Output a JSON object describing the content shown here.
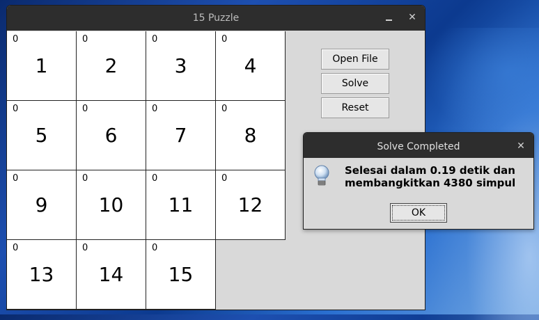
{
  "window": {
    "title": "15 Puzzle",
    "minimize_icon": "minimize-icon",
    "close_icon": "close-icon"
  },
  "board": {
    "tiles": [
      {
        "count": "0",
        "number": "1"
      },
      {
        "count": "0",
        "number": "2"
      },
      {
        "count": "0",
        "number": "3"
      },
      {
        "count": "0",
        "number": "4"
      },
      {
        "count": "0",
        "number": "5"
      },
      {
        "count": "0",
        "number": "6"
      },
      {
        "count": "0",
        "number": "7"
      },
      {
        "count": "0",
        "number": "8"
      },
      {
        "count": "0",
        "number": "9"
      },
      {
        "count": "0",
        "number": "10"
      },
      {
        "count": "0",
        "number": "11"
      },
      {
        "count": "0",
        "number": "12"
      },
      {
        "count": "0",
        "number": "13"
      },
      {
        "count": "0",
        "number": "14"
      },
      {
        "count": "0",
        "number": "15"
      }
    ]
  },
  "controls": {
    "open_file": "Open File",
    "solve": "Solve",
    "reset": "Reset"
  },
  "dialog": {
    "title": "Solve Completed",
    "icon": "lightbulb-icon",
    "line1": "Selesai dalam 0.19 detik dan",
    "line2": "membangkitkan 4380 simpul",
    "ok_label": "OK"
  }
}
